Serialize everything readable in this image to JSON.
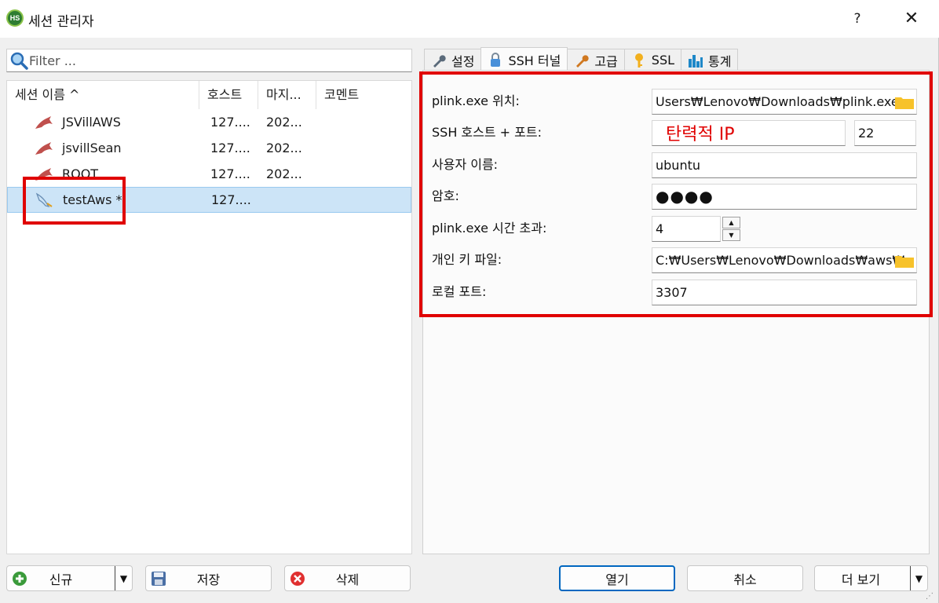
{
  "window": {
    "app_icon_text": "HS",
    "title": "세션 관리자",
    "help": "?",
    "close": "✕"
  },
  "filter": {
    "placeholder": "Filter ..."
  },
  "tree": {
    "columns": [
      "세션 이름  ^",
      "호스트",
      "마지...",
      "코멘트"
    ],
    "rows": [
      {
        "name": "JSVillAWS",
        "host": "127....",
        "last": "202...",
        "selected": false
      },
      {
        "name": "jsvillSean",
        "host": "127....",
        "last": "202...",
        "selected": false
      },
      {
        "name": "ROOT",
        "host": "127....",
        "last": "202...",
        "selected": false
      },
      {
        "name": "testAws *",
        "host": "127....",
        "last": "",
        "selected": true
      }
    ]
  },
  "left_buttons": {
    "new": "신규",
    "save": "저장",
    "delete": "삭제"
  },
  "tabs": [
    {
      "label": "설정",
      "icon": "wrench-icon"
    },
    {
      "label": "SSH 터널",
      "icon": "lock-icon",
      "active": true
    },
    {
      "label": "고급",
      "icon": "wrench-icon"
    },
    {
      "label": "SSL",
      "icon": "key-icon"
    },
    {
      "label": "통계",
      "icon": "bar-chart-icon"
    }
  ],
  "ssh": {
    "plink_label": "plink.exe 위치:",
    "plink_value": "Users₩Lenovo₩Downloads₩plink.exe",
    "host_label": "SSH 호스트 + 포트:",
    "host_value": "",
    "port_value": "22",
    "user_label": "사용자 이름:",
    "user_value": "ubuntu",
    "password_label": "암호:",
    "password_value": "●●●●",
    "timeout_label": "plink.exe 시간 초과:",
    "timeout_value": "4",
    "key_label": "개인 키 파일:",
    "key_value": "C:₩Users₩Lenovo₩Downloads₩aws₩",
    "local_port_label": "로컬 포트:",
    "local_port_value": "3307"
  },
  "annotation": "탄력적 IP",
  "bottom_buttons": {
    "open": "열기",
    "cancel": "취소",
    "more": "더 보기"
  },
  "colors": {
    "highlight": "#e00000",
    "selection": "#cce4f7",
    "accent": "#0067c0"
  }
}
